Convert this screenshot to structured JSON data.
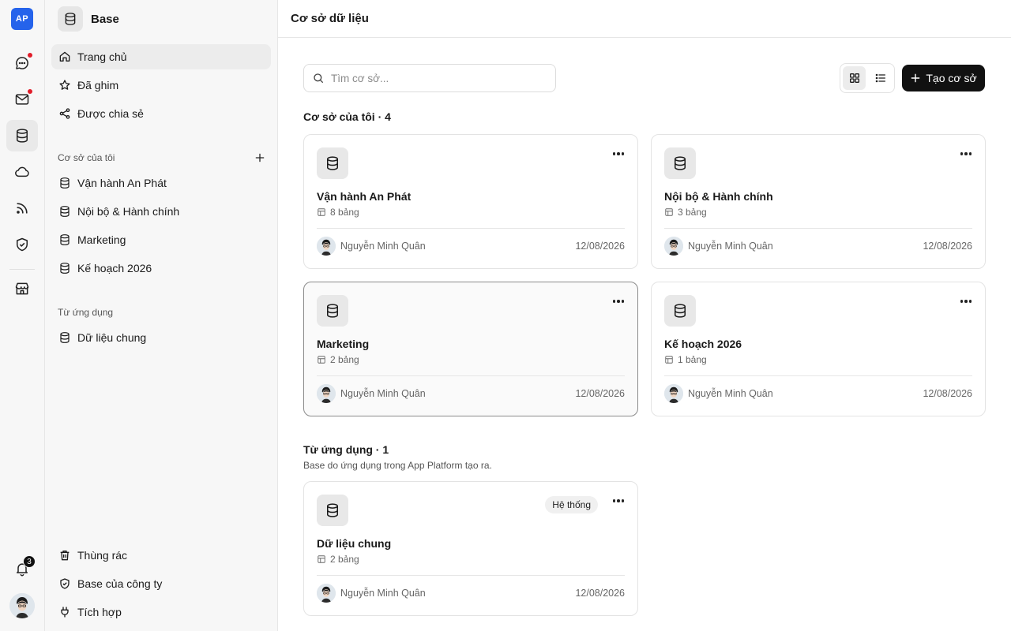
{
  "app": {
    "logo_text": "AP"
  },
  "rail": {
    "items": [
      {
        "icon": "chat-icon",
        "dot": true
      },
      {
        "icon": "mail-icon",
        "dot": true
      },
      {
        "icon": "database-icon",
        "active": true
      },
      {
        "icon": "cloud-icon"
      },
      {
        "icon": "rss-icon"
      },
      {
        "icon": "shield-check-icon"
      },
      {
        "icon": "store-icon"
      }
    ],
    "notifications_count": "3"
  },
  "sidebar": {
    "title": "Base",
    "nav": [
      {
        "label": "Trang chủ",
        "icon": "home-icon",
        "active": true
      },
      {
        "label": "Đã ghim",
        "icon": "star-icon"
      },
      {
        "label": "Được chia sẻ",
        "icon": "share-icon"
      }
    ],
    "my_bases_label": "Cơ sở của tôi",
    "my_bases": [
      {
        "label": "Vận hành An Phát"
      },
      {
        "label": "Nội bộ & Hành chính"
      },
      {
        "label": "Marketing"
      },
      {
        "label": "Kế hoạch 2026"
      }
    ],
    "from_apps_label": "Từ ứng dụng",
    "from_apps": [
      {
        "label": "Dữ liệu chung"
      }
    ],
    "bottom": [
      {
        "label": "Thùng rác",
        "icon": "trash-icon"
      },
      {
        "label": "Base của công ty",
        "icon": "shield-check-icon"
      },
      {
        "label": "Tích hợp",
        "icon": "plug-icon"
      }
    ]
  },
  "main": {
    "title": "Cơ sở dữ liệu",
    "search_placeholder": "Tìm cơ sở...",
    "create_label": "Tạo cơ sở",
    "my_section_title": "Cơ sở của tôi · 4",
    "app_section_title": "Từ ứng dụng · 1",
    "app_section_subtitle": "Base do ứng dụng trong App Platform tạo ra.",
    "my_cards": [
      {
        "name": "Vận hành An Phát",
        "count": "8 bảng",
        "owner": "Nguyễn Minh Quân",
        "date": "12/08/2026"
      },
      {
        "name": "Nội bộ & Hành chính",
        "count": "3 bảng",
        "owner": "Nguyễn Minh Quân",
        "date": "12/08/2026"
      },
      {
        "name": "Marketing",
        "count": "2 bảng",
        "owner": "Nguyễn Minh Quân",
        "date": "12/08/2026"
      },
      {
        "name": "Kế hoạch 2026",
        "count": "1 bảng",
        "owner": "Nguyễn Minh Quân",
        "date": "12/08/2026"
      }
    ],
    "app_cards": [
      {
        "name": "Dữ liệu chung",
        "count": "2 bảng",
        "owner": "Nguyễn Minh Quân",
        "date": "12/08/2026",
        "badge": "Hệ thống"
      }
    ]
  }
}
